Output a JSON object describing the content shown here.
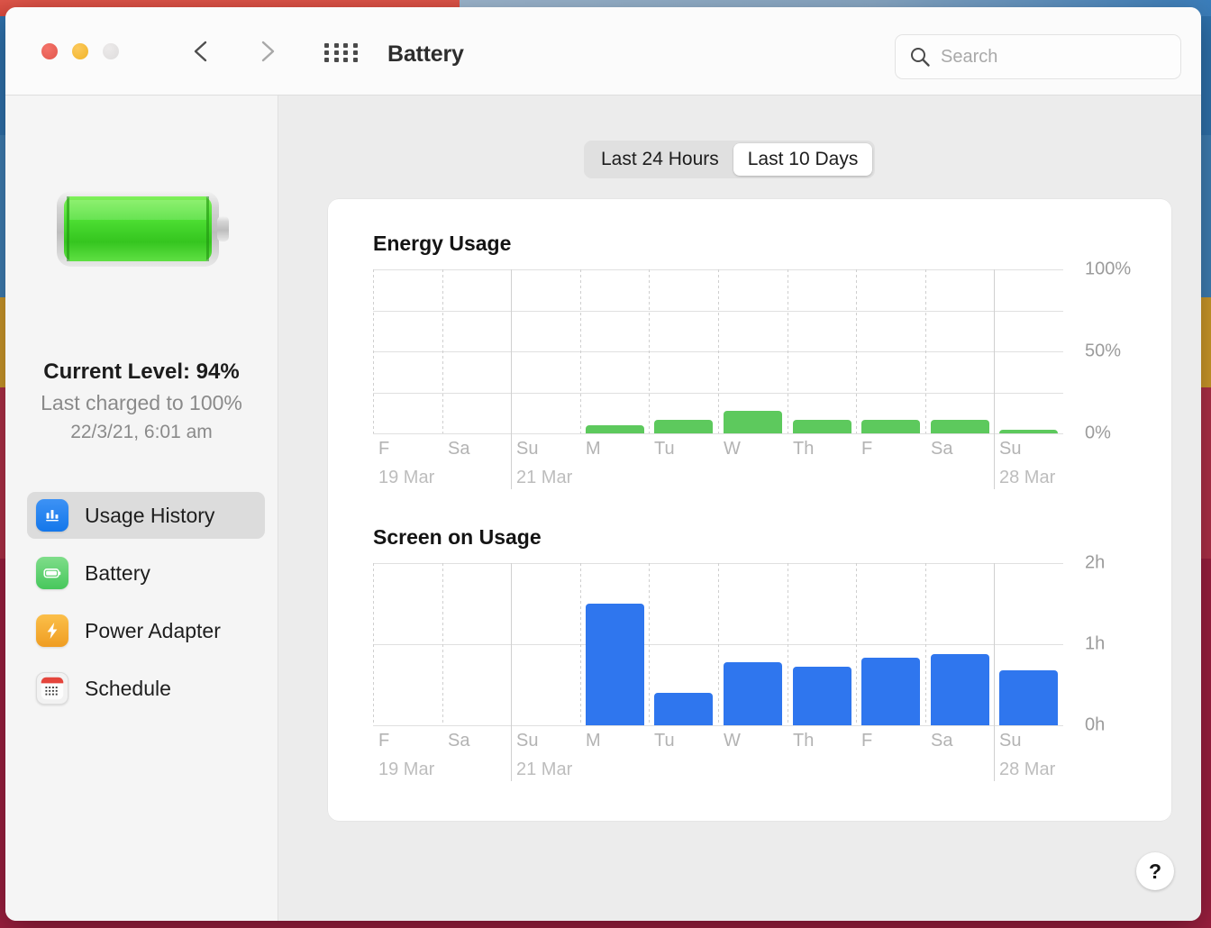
{
  "window": {
    "title": "Battery",
    "traffic_lights": [
      "close",
      "minimize",
      "zoom"
    ],
    "back_icon": "chevron-left-icon",
    "forward_icon": "chevron-right-icon",
    "grid_icon": "app-grid-icon"
  },
  "search": {
    "placeholder": "Search",
    "value": "",
    "icon": "search-icon"
  },
  "sidebar": {
    "battery_icon": "battery-full-icon",
    "current_level": "Current Level: 94%",
    "last_charged": "Last charged to 100%",
    "charge_time": "22/3/21, 6:01 am",
    "items": [
      {
        "label": "Usage History",
        "icon": "bar-chart-icon",
        "selected": true
      },
      {
        "label": "Battery",
        "icon": "battery-icon",
        "selected": false
      },
      {
        "label": "Power Adapter",
        "icon": "bolt-icon",
        "selected": false
      },
      {
        "label": "Schedule",
        "icon": "calendar-icon",
        "selected": false
      }
    ]
  },
  "segmented_control": {
    "options": [
      "Last 24 Hours",
      "Last 10 Days"
    ],
    "selected": "Last 10 Days"
  },
  "help_button": {
    "label": "?",
    "icon": "question-mark-icon"
  },
  "colors": {
    "energy_bar": "#5dc95d",
    "screen_bar": "#2f76ee",
    "accent_blue": "#1477ea",
    "sidebar_bg": "#f5f5f5",
    "content_bg": "#ececec",
    "card_bg": "#ffffff"
  },
  "chart_data": [
    {
      "type": "bar",
      "title": "Energy Usage",
      "xlabel": "",
      "ylabel": "",
      "categories": [
        "F",
        "Sa",
        "Su",
        "M",
        "Tu",
        "W",
        "Th",
        "F",
        "Sa",
        "Su"
      ],
      "date_labels": [
        {
          "index": 0,
          "text": "19 Mar"
        },
        {
          "index": 2,
          "text": "21 Mar"
        },
        {
          "index": 9,
          "text": "28 Mar"
        }
      ],
      "values": [
        0,
        0,
        0,
        5,
        8,
        14,
        8,
        8,
        8,
        2
      ],
      "ylim": [
        0,
        100
      ],
      "yticks": [
        0,
        25,
        50,
        75,
        100
      ],
      "ytick_labels": [
        "0%",
        "",
        "50%",
        "",
        "100%"
      ],
      "unit": "%",
      "grid": true,
      "legend": "none"
    },
    {
      "type": "bar",
      "title": "Screen on Usage",
      "xlabel": "",
      "ylabel": "",
      "categories": [
        "F",
        "Sa",
        "Su",
        "M",
        "Tu",
        "W",
        "Th",
        "F",
        "Sa",
        "Su"
      ],
      "date_labels": [
        {
          "index": 0,
          "text": "19 Mar"
        },
        {
          "index": 2,
          "text": "21 Mar"
        },
        {
          "index": 9,
          "text": "28 Mar"
        }
      ],
      "values": [
        0,
        0,
        0,
        1.5,
        0.4,
        0.78,
        0.72,
        0.83,
        0.88,
        0.68
      ],
      "ylim": [
        0,
        2
      ],
      "yticks": [
        0,
        1,
        2
      ],
      "ytick_labels": [
        "0h",
        "1h",
        "2h"
      ],
      "unit": "h",
      "grid": true,
      "legend": "none"
    }
  ]
}
